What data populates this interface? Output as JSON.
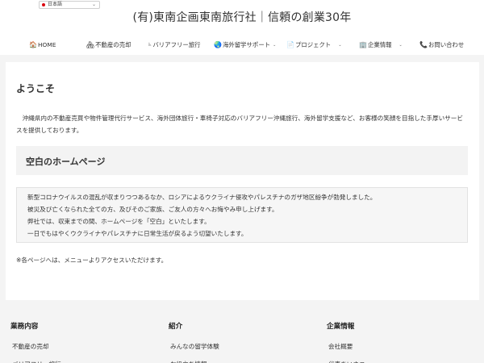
{
  "header": {
    "language": "日本語",
    "site_title": "(有)東南企画東南旅行社｜信頼の創業30年"
  },
  "nav": [
    {
      "icon": "🏠",
      "label": "HOME",
      "dropdown": false
    },
    {
      "icon": "🏘",
      "label": "不動産の売却",
      "dropdown": false
    },
    {
      "icon": "♿",
      "label": "バリアフリー旅行",
      "dropdown": false
    },
    {
      "icon": "🌏",
      "label": "海外留学サポート",
      "dropdown": true
    },
    {
      "icon": "📄",
      "label": "プロジェクト",
      "dropdown": true
    },
    {
      "icon": "🏢",
      "label": "企業情報",
      "dropdown": true
    },
    {
      "icon": "📞",
      "label": "お問い合わせ",
      "dropdown": false
    }
  ],
  "main": {
    "welcome_heading": "ようこそ",
    "intro": "　沖縄県内の不動産売買や物件管理代行サービス、海外団体旅行・車椅子対応のバリアフリー沖縄旅行、海外留学支援など、お客様の笑顔を目指した手厚いサービスを提供しております。",
    "section_heading": "空白のホームページ",
    "notice_lines": [
      "新型コロナウイルスの混乱が収まりつつあるなか、ロシアによるウクライナ侵攻やパレスチナのガザ地区紛争が勃発しました。",
      "被災及び亡くなられた全ての方、及びそのご家族、ご友人の方々へお悔やみ申し上げます。",
      "弊社では、収束までの間、ホームページを「空白」といたします。",
      "一日でもはやくウクライナやパレスチナに日常生活が戻るよう切望いたします。"
    ],
    "footnote": "※各ページへは、メニューよりアクセスいただけます。"
  },
  "footer": {
    "columns": [
      {
        "heading": "業務内容",
        "links": [
          "不動産の売却",
          "バリアフリー旅行"
        ]
      },
      {
        "heading": "紹介",
        "links": [
          "みんなの留学体験",
          "お役立ち情報"
        ]
      },
      {
        "heading": "企業情報",
        "links": [
          "会社概要",
          "代表あいさつ"
        ]
      }
    ]
  }
}
